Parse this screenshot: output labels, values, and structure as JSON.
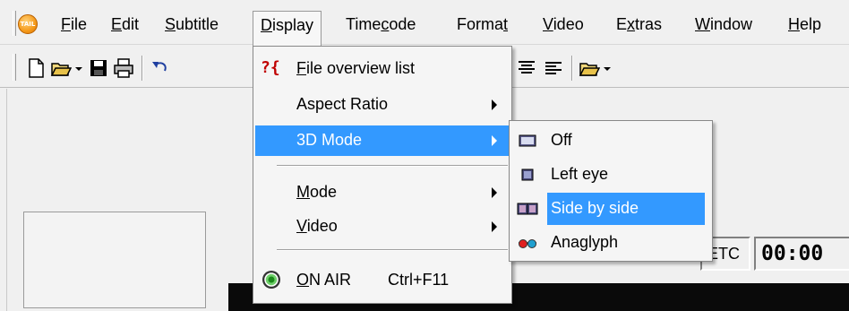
{
  "menubar": {
    "items": [
      {
        "label": "File",
        "accel": "F",
        "rest": "ile"
      },
      {
        "label": "Edit",
        "accel": "E",
        "rest": "dit"
      },
      {
        "label": "Subtitle",
        "accel": "S",
        "rest": "ubtitle"
      },
      {
        "label": "Display",
        "accel": "D",
        "rest": "isplay"
      },
      {
        "label": "Timecode",
        "pre": "Time",
        "accel": "c",
        "rest": "ode"
      },
      {
        "label": "Format",
        "pre": "Forma",
        "accel": "t",
        "rest": ""
      },
      {
        "label": "Video",
        "accel": "V",
        "rest": "ideo"
      },
      {
        "label": "Extras",
        "pre": "E",
        "accel": "x",
        "rest": "tras"
      },
      {
        "label": "Window",
        "accel": "W",
        "rest": "indow"
      },
      {
        "label": "Help",
        "accel": "H",
        "rest": "elp"
      }
    ]
  },
  "display_menu": {
    "file_overview": {
      "icon_text": "?{",
      "accel": "F",
      "rest": "ile overview list"
    },
    "aspect_ratio": "Aspect Ratio",
    "mode_3d": "3D Mode",
    "mode": {
      "accel": "M",
      "rest": "ode"
    },
    "video": {
      "accel": "V",
      "rest": "ideo"
    },
    "on_air": {
      "accel": "O",
      "rest": "N AIR",
      "shortcut": "Ctrl+F11"
    }
  },
  "submenu_3d": {
    "items": [
      "Off",
      "Left eye",
      "Side by side",
      "Anaglyph"
    ]
  },
  "status": {
    "etc_label": "ETC",
    "timecode": "00:00"
  },
  "app_logo_text": "TAIL",
  "colors": {
    "highlight": "#3399ff",
    "menubar_bg": "#f0f0f0",
    "logo": "#f59a1a"
  }
}
